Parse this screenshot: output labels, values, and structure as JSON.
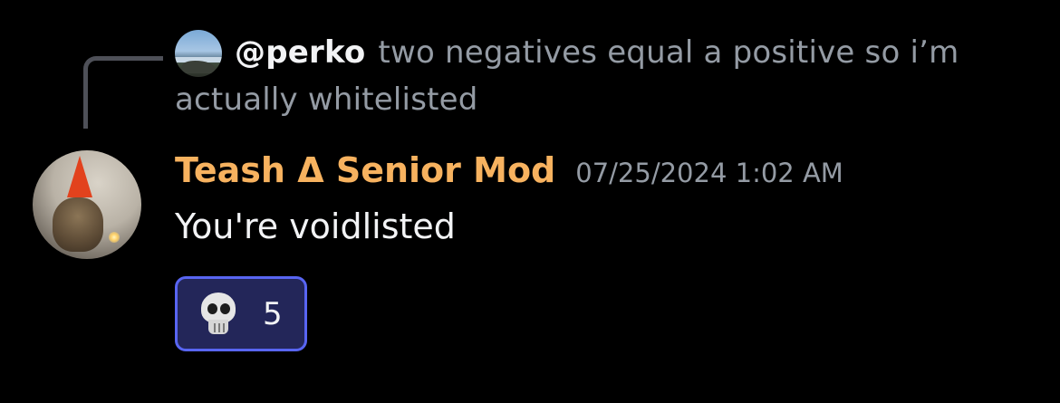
{
  "reply": {
    "author": "@perko",
    "text": "two negatives equal a positive so i’m actually whitelisted"
  },
  "message": {
    "username": "Teash Δ Senior Mod",
    "timestamp": "07/25/2024 1:02 AM",
    "content": "You're voidlisted"
  },
  "reaction": {
    "emoji": "skull-icon",
    "count": "5"
  },
  "colors": {
    "background": "#000000",
    "username": "#f7b25f",
    "reaction_border": "#5865f2",
    "reaction_bg": "#232659"
  }
}
